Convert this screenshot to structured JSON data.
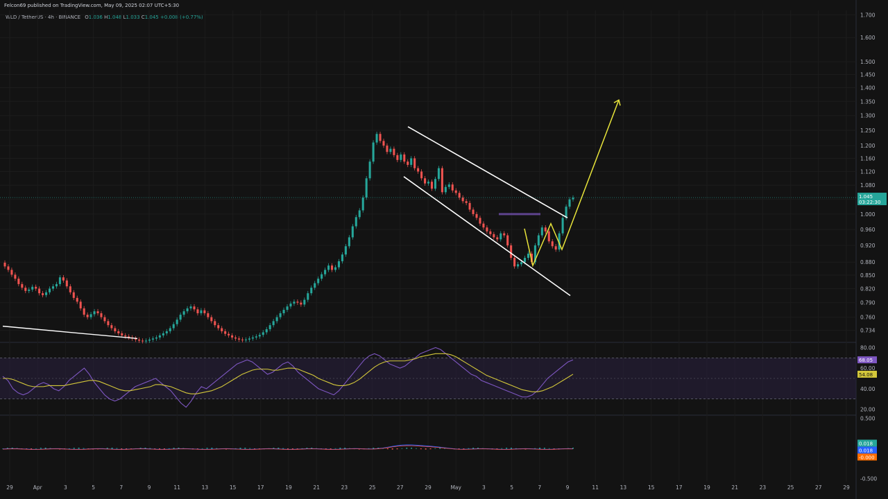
{
  "header": {
    "published": "Felcon69 published on TradingView.com, May 09, 2025 02:07 UTC+5:30"
  },
  "legend": {
    "symbol": "WLD / TetherUS · 4h · BINANCE",
    "open_label": "O",
    "open": "1.036",
    "high_label": "H",
    "high": "1.048",
    "low_label": "L",
    "low": "1.033",
    "close_label": "C",
    "close": "1.045",
    "change": "+0.008 (+0.77%)"
  },
  "colors": {
    "background": "#131313",
    "up": "#26a69a",
    "down": "#ef5350",
    "channel": "#ffffff",
    "projection": "#e8e43a",
    "rsi": "#7e57c2",
    "rsi_ma": "#d4c83a",
    "rsi_band": "#2a2140",
    "macd": "#2962ff",
    "signal": "#ff6d00"
  },
  "price_tag": {
    "value": "1.045",
    "countdown": "03:22:30"
  },
  "rsi_tags": {
    "rsi": "68.05",
    "ma": "54.08"
  },
  "macd_tags": {
    "macd": "0.018",
    "signal": "0.018",
    "hist": "-0.000"
  },
  "chart_data": [
    {
      "type": "candlestick",
      "symbol": "WLD / TetherUS",
      "timeframe": "4h",
      "exchange": "BINANCE",
      "y_ticks": [
        1.7,
        1.6,
        1.5,
        1.45,
        1.4,
        1.35,
        1.3,
        1.25,
        1.2,
        1.16,
        1.12,
        1.08,
        1.04,
        1.0,
        0.96,
        0.92,
        0.88,
        0.85,
        0.82,
        0.79,
        0.76,
        0.734
      ],
      "y_tick_labels": [
        "1.700",
        "1.600",
        "1.500",
        "1.450",
        "1.400",
        "1.350",
        "1.300",
        "1.250",
        "1.200",
        "1.160",
        "1.120",
        "1.080",
        "1.040",
        "1.000",
        "0.960",
        "0.920",
        "0.880",
        "0.850",
        "0.820",
        "0.790",
        "0.760",
        "0.734"
      ],
      "x_tick_labels": [
        "29",
        "Apr",
        "3",
        "5",
        "7",
        "9",
        "11",
        "13",
        "15",
        "17",
        "19",
        "21",
        "23",
        "25",
        "27",
        "29",
        "May",
        "3",
        "5",
        "7",
        "9",
        "11",
        "13",
        "15",
        "17",
        "19",
        "21",
        "23",
        "25",
        "27",
        "29"
      ],
      "log_scale": true,
      "closes": [
        0.87,
        0.862,
        0.851,
        0.842,
        0.83,
        0.822,
        0.815,
        0.818,
        0.824,
        0.82,
        0.81,
        0.806,
        0.812,
        0.82,
        0.825,
        0.83,
        0.845,
        0.838,
        0.825,
        0.812,
        0.8,
        0.792,
        0.778,
        0.765,
        0.76,
        0.766,
        0.772,
        0.768,
        0.76,
        0.752,
        0.744,
        0.738,
        0.732,
        0.728,
        0.724,
        0.722,
        0.72,
        0.718,
        0.716,
        0.714,
        0.713,
        0.714,
        0.716,
        0.718,
        0.72,
        0.724,
        0.728,
        0.732,
        0.738,
        0.746,
        0.755,
        0.765,
        0.772,
        0.778,
        0.782,
        0.776,
        0.768,
        0.774,
        0.768,
        0.76,
        0.752,
        0.744,
        0.738,
        0.732,
        0.727,
        0.724,
        0.72,
        0.718,
        0.716,
        0.715,
        0.716,
        0.718,
        0.72,
        0.722,
        0.725,
        0.73,
        0.736,
        0.744,
        0.752,
        0.76,
        0.768,
        0.775,
        0.782,
        0.788,
        0.792,
        0.79,
        0.786,
        0.796,
        0.81,
        0.822,
        0.832,
        0.842,
        0.852,
        0.862,
        0.872,
        0.862,
        0.868,
        0.882,
        0.898,
        0.918,
        0.94,
        0.968,
        0.992,
        1.01,
        1.045,
        1.1,
        1.15,
        1.21,
        1.238,
        1.215,
        1.2,
        1.18,
        1.19,
        1.17,
        1.155,
        1.172,
        1.15,
        1.14,
        1.16,
        1.13,
        1.12,
        1.1,
        1.085,
        1.09,
        1.07,
        1.098,
        1.13,
        1.06,
        1.075,
        1.082,
        1.065,
        1.058,
        1.045,
        1.035,
        1.03,
        1.012,
        1.0,
        0.99,
        0.975,
        0.965,
        0.955,
        0.948,
        0.94,
        0.935,
        0.95,
        0.945,
        0.92,
        0.89,
        0.87,
        0.875,
        0.88,
        0.89,
        0.9,
        0.88,
        0.92,
        0.945,
        0.965,
        0.955,
        0.93,
        0.918,
        0.91,
        0.95,
        0.99,
        1.02,
        1.04,
        1.045
      ]
    },
    {
      "type": "line",
      "name": "RSI",
      "y_ticks": [
        80.0,
        60.0,
        40.0,
        20.0
      ],
      "y_tick_labels": [
        "80.00",
        "60.00",
        "40.00",
        "20.00"
      ],
      "bands": [
        70,
        30
      ],
      "ylim": [
        15,
        85
      ],
      "rsi": [
        52,
        48,
        40,
        36,
        34,
        36,
        40,
        44,
        46,
        44,
        40,
        38,
        42,
        48,
        52,
        56,
        60,
        54,
        46,
        40,
        34,
        30,
        28,
        30,
        34,
        38,
        42,
        44,
        46,
        48,
        50,
        46,
        42,
        38,
        32,
        26,
        22,
        28,
        36,
        42,
        40,
        44,
        48,
        52,
        56,
        60,
        64,
        66,
        68,
        66,
        62,
        58,
        54,
        56,
        60,
        64,
        66,
        62,
        56,
        52,
        48,
        44,
        40,
        38,
        36,
        34,
        38,
        44,
        50,
        56,
        62,
        68,
        72,
        74,
        72,
        68,
        64,
        62,
        60,
        62,
        66,
        70,
        74,
        76,
        78,
        80,
        78,
        74,
        70,
        66,
        62,
        58,
        54,
        52,
        48,
        46,
        44,
        42,
        40,
        38,
        36,
        34,
        32,
        32,
        34,
        38,
        44,
        50,
        54,
        58,
        62,
        66,
        68
      ],
      "ma": [
        50,
        50,
        49,
        47,
        45,
        43,
        42,
        42,
        42,
        43,
        43,
        43,
        43,
        44,
        45,
        46,
        47,
        48,
        48,
        47,
        45,
        43,
        41,
        39,
        38,
        38,
        39,
        40,
        41,
        42,
        44,
        44,
        43,
        42,
        40,
        38,
        36,
        35,
        35,
        36,
        37,
        38,
        40,
        42,
        45,
        48,
        51,
        54,
        56,
        58,
        59,
        59,
        59,
        58,
        58,
        59,
        60,
        60,
        59,
        57,
        55,
        53,
        50,
        48,
        46,
        44,
        43,
        43,
        44,
        46,
        49,
        53,
        57,
        61,
        64,
        66,
        67,
        67,
        67,
        67,
        68,
        69,
        71,
        72,
        73,
        74,
        74,
        74,
        73,
        71,
        68,
        65,
        62,
        59,
        56,
        53,
        51,
        49,
        47,
        45,
        43,
        41,
        39,
        38,
        37,
        37,
        38,
        40,
        42,
        45,
        48,
        51,
        54.08
      ]
    },
    {
      "type": "line",
      "name": "MACD",
      "y_ticks": [
        0.5,
        -0.5
      ],
      "y_tick_labels": [
        "0.500",
        "-0.500"
      ],
      "ylim": [
        -0.55,
        0.55
      ]
    }
  ]
}
